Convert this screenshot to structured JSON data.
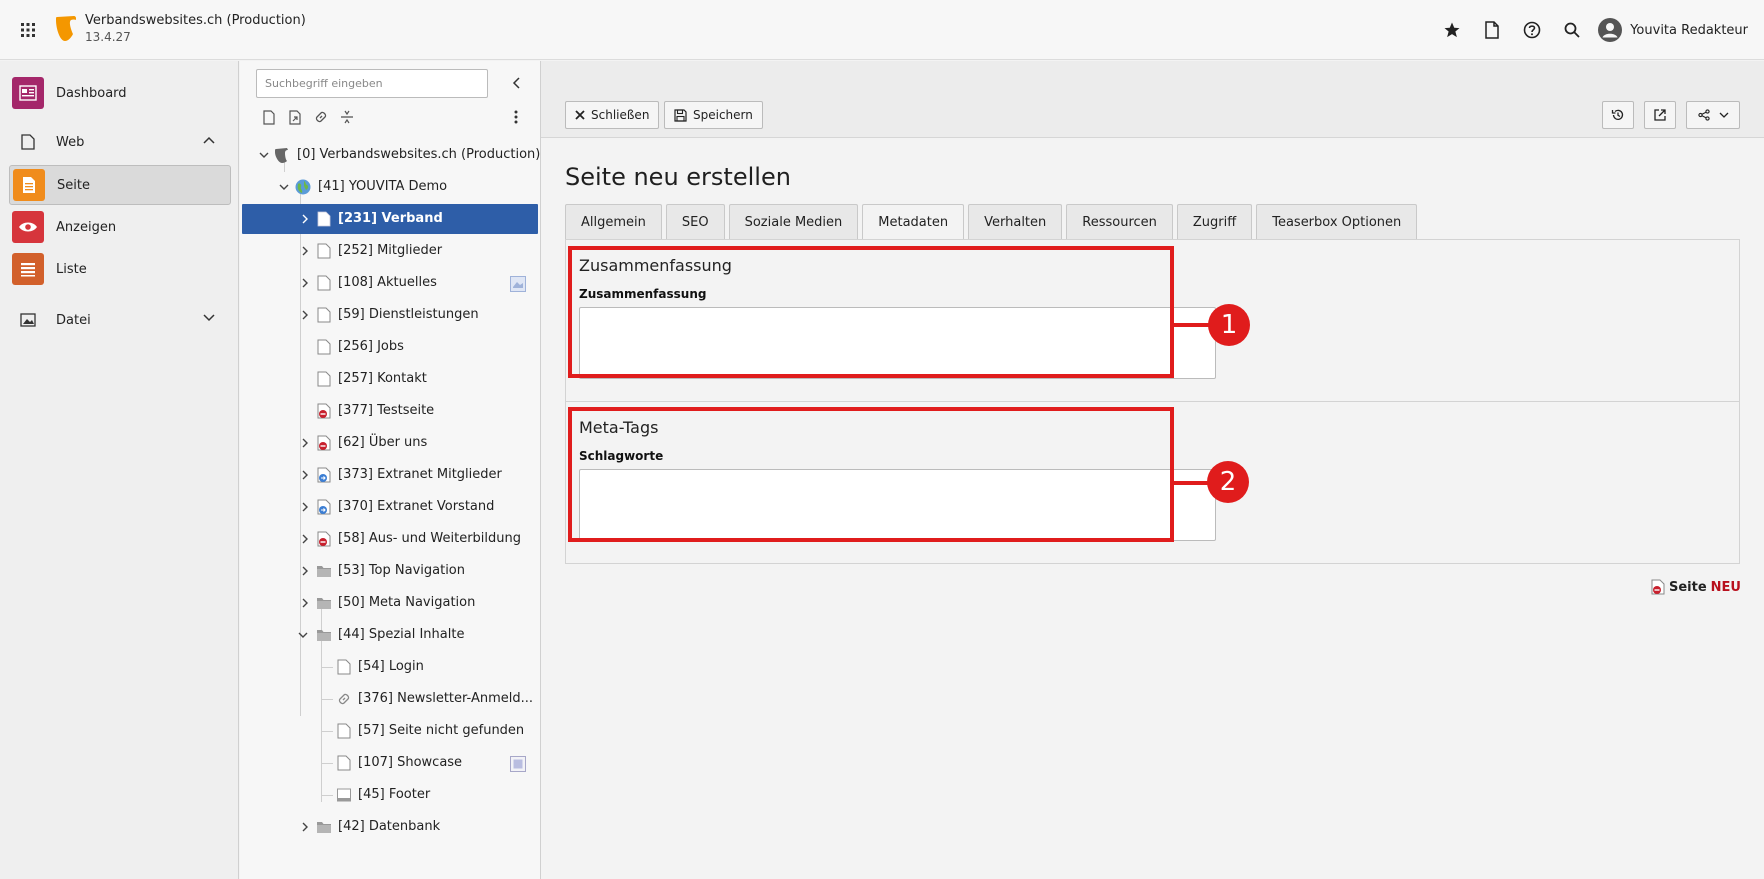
{
  "app": {
    "site_title": "Verbandswebsites.ch (Production)",
    "version": "13.4.27",
    "user_name": "Youvita Redakteur",
    "brand_color": "#f49700"
  },
  "topbar_icons": [
    "star-icon",
    "page-icon",
    "help-icon",
    "search-icon"
  ],
  "modules": {
    "dashboard": "Dashboard",
    "web": "Web",
    "seite": "Seite",
    "anzeigen": "Anzeigen",
    "liste": "Liste",
    "datei": "Datei"
  },
  "tree": {
    "search_placeholder": "Suchbegriff eingeben",
    "nodes": [
      {
        "label": "[0] Verbandswebsites.ch (Production)",
        "icon": "typo3-root-icon"
      },
      {
        "label": "[41] YOUVITA Demo",
        "icon": "globe-icon"
      },
      {
        "label": "[231] Verband",
        "icon": "page-icon",
        "selected": true
      },
      {
        "label": "[252] Mitglieder",
        "icon": "page-icon"
      },
      {
        "label": "[108] Aktuelles",
        "icon": "page-icon"
      },
      {
        "label": "[59] Dienstleistungen",
        "icon": "page-icon"
      },
      {
        "label": "[256] Jobs",
        "icon": "page-icon"
      },
      {
        "label": "[257] Kontakt",
        "icon": "page-icon"
      },
      {
        "label": "[377] Testseite",
        "icon": "page-hidden-icon"
      },
      {
        "label": "[62] Über uns",
        "icon": "page-hidden-icon"
      },
      {
        "label": "[373] Extranet Mitglieder",
        "icon": "page-restricted-icon"
      },
      {
        "label": "[370] Extranet Vorstand",
        "icon": "page-restricted-icon"
      },
      {
        "label": "[58] Aus- und Weiterbildung",
        "icon": "page-hidden-icon"
      },
      {
        "label": "[53] Top Navigation",
        "icon": "folder-icon"
      },
      {
        "label": "[50] Meta Navigation",
        "icon": "folder-icon"
      },
      {
        "label": "[44] Spezial Inhalte",
        "icon": "folder-icon"
      },
      {
        "label": "[54] Login",
        "icon": "page-icon"
      },
      {
        "label": "[376] Newsletter-Anmeld...",
        "icon": "link-icon"
      },
      {
        "label": "[57] Seite nicht gefunden",
        "icon": "page-icon"
      },
      {
        "label": "[107] Showcase",
        "icon": "page-icon"
      },
      {
        "label": "[45] Footer",
        "icon": "footer-page-icon"
      },
      {
        "label": "[42] Datenbank",
        "icon": "folder-icon"
      }
    ]
  },
  "docheader": {
    "close_label": "Schließen",
    "save_label": "Speichern"
  },
  "form": {
    "page_title": "Seite neu erstellen",
    "tabs": [
      "Allgemein",
      "SEO",
      "Soziale Medien",
      "Metadaten",
      "Verhalten",
      "Ressourcen",
      "Zugriff",
      "Teaserbox Optionen"
    ],
    "active_tab": "Metadaten",
    "section1_title": "Zusammenfassung",
    "section1_field_label": "Zusammenfassung",
    "section1_field_value": "",
    "section2_title": "Meta-Tags",
    "section2_field_label": "Schlagworte",
    "section2_field_value": ""
  },
  "annotations": {
    "marker1": "1",
    "marker2": "2",
    "color": "#e01c1c"
  },
  "footer": {
    "record_label": "Seite",
    "new_label": "NEU"
  }
}
